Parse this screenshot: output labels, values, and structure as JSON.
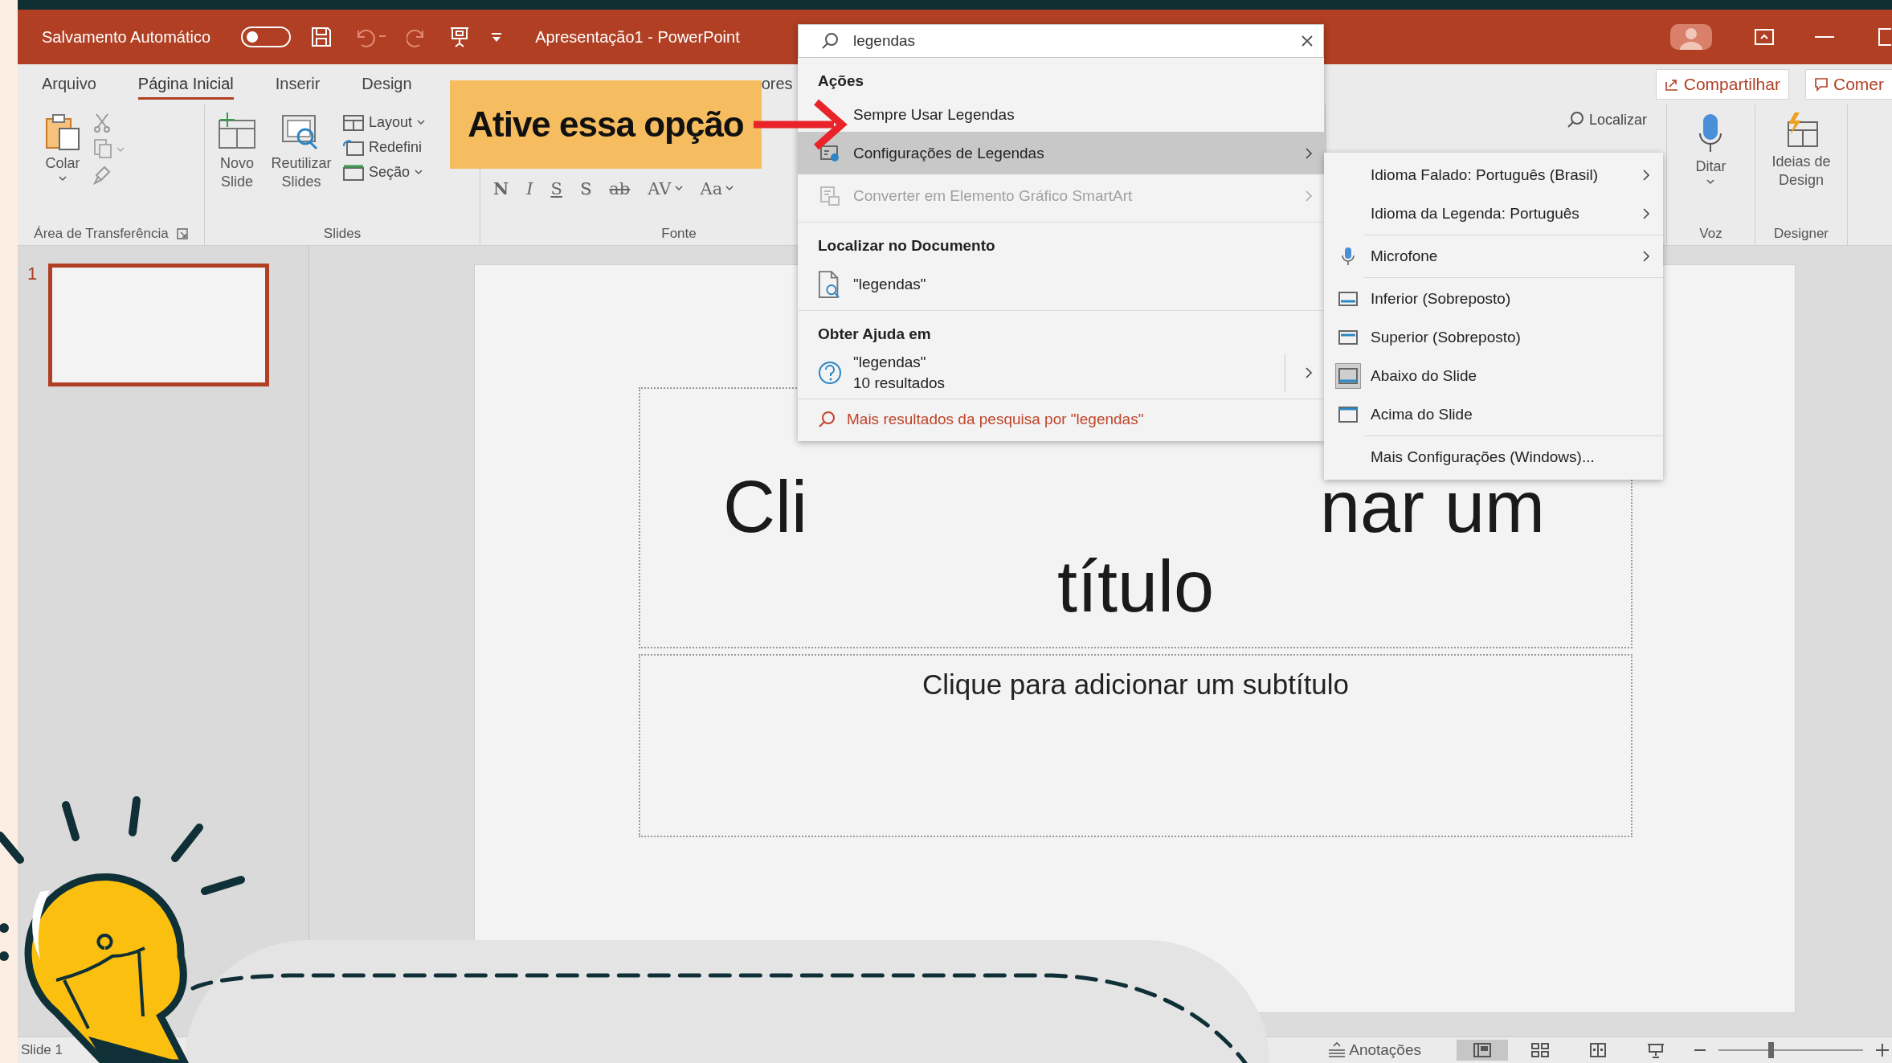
{
  "title_bar": {
    "autosave_label": "Salvamento Automático",
    "autosave_on": false,
    "document_title": "Apresentação1 - PowerPoint"
  },
  "ribbon_tabs": [
    {
      "label": "Arquivo",
      "selected": false
    },
    {
      "label": "Página Inicial",
      "selected": true
    },
    {
      "label": "Inserir",
      "selected": false
    },
    {
      "label": "Design",
      "selected": false
    },
    {
      "label": "ores",
      "selected": false
    }
  ],
  "share_buttons": [
    {
      "kind": "share",
      "label": "Compartilhar"
    },
    {
      "kind": "comment",
      "label": "Comer"
    }
  ],
  "ribbon_groups": [
    {
      "kind": "clipboard",
      "label": "Área de Transferência",
      "paste": "Colar"
    },
    {
      "kind": "slides",
      "label": "Slides",
      "new_slide": "Novo Slide",
      "reuse": "Reutilizar Slides",
      "layout": "Layout",
      "reset": "Redefini",
      "section": "Seção"
    },
    {
      "kind": "font",
      "label": "Fonte",
      "formats": [
        {
          "kind": "bold",
          "label": "N"
        },
        {
          "kind": "italic",
          "label": "I"
        },
        {
          "kind": "underline",
          "label": "S"
        },
        {
          "kind": "shadow",
          "label": "S"
        },
        {
          "kind": "strike",
          "label": "ab"
        },
        {
          "kind": "spacing",
          "label": "AV"
        },
        {
          "kind": "case",
          "label": "Aa"
        }
      ]
    },
    {
      "kind": "editing",
      "find": "Localizar"
    },
    {
      "kind": "voice",
      "label": "Voz",
      "dictate": "Ditar"
    },
    {
      "kind": "designer",
      "label": "Designer",
      "ideas": "Ideias de Design"
    }
  ],
  "slide_thumbnails": [
    {
      "number": "1",
      "selected": true
    }
  ],
  "slide": {
    "title_visible_parts": [
      "Cli",
      "nar um",
      "título"
    ],
    "subtitle": "Clique para adicionar um subtítulo"
  },
  "status_bar": {
    "slide": "Slide 1",
    "notes": "Anotações",
    "views": [
      {
        "kind": "normal",
        "selected": true
      },
      {
        "kind": "sorter",
        "selected": false
      },
      {
        "kind": "reading",
        "selected": false
      },
      {
        "kind": "show",
        "selected": false
      }
    ],
    "zoom_level": {
      "level": 0.36
    }
  },
  "search": {
    "query": "legendas",
    "sections": [
      {
        "heading": "Ações",
        "items": [
          {
            "kind": "plain",
            "label": "Sempre Usar Legendas",
            "selected": false,
            "disabled": false,
            "submenu": false
          },
          {
            "kind": "captions",
            "label": "Configurações de Legendas",
            "selected": true,
            "disabled": false,
            "submenu": true
          },
          {
            "kind": "smartart",
            "label": "Converter em Elemento Gráfico SmartArt",
            "selected": false,
            "disabled": true,
            "submenu": true
          }
        ]
      },
      {
        "heading": "Localizar no Documento",
        "items": [
          {
            "kind": "document",
            "label": "\"legendas\""
          }
        ]
      },
      {
        "heading": "Obter Ajuda em",
        "items": [
          {
            "kind": "help",
            "label": "\"legendas\"",
            "detail": "10 resultados"
          }
        ]
      }
    ],
    "more_results": "Mais resultados da pesquisa por \"legendas\""
  },
  "caption_submenu": [
    {
      "kind": "language",
      "label": "Idioma Falado: Português (Brasil)"
    },
    {
      "kind": "language",
      "label": "Idioma da Legenda: Português"
    },
    {
      "kind": "mic",
      "label": "Microfone"
    },
    {
      "kind": "bottom",
      "label": "Inferior (Sobreposto)",
      "selected": false
    },
    {
      "kind": "top",
      "label": "Superior (Sobreposto)",
      "selected": false
    },
    {
      "kind": "below",
      "label": "Abaixo do Slide",
      "selected": true
    },
    {
      "kind": "above",
      "label": "Acima do Slide",
      "selected": false
    },
    {
      "kind": "more",
      "label": "Mais Configurações (Windows)..."
    }
  ],
  "callout": "Ative essa opção"
}
